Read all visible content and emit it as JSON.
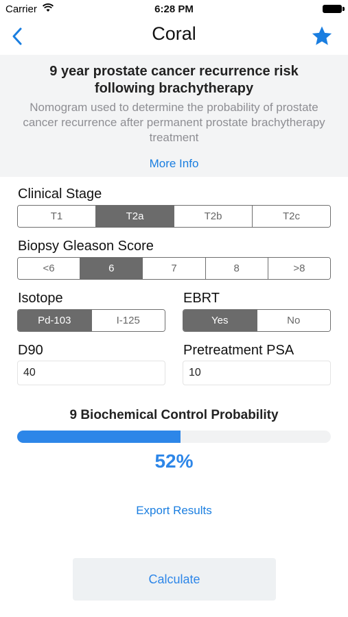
{
  "status_bar": {
    "carrier": "Carrier",
    "time": "6:28 PM"
  },
  "nav": {
    "title": "Coral",
    "back_icon": "chevron-left-icon",
    "favorite_icon": "star-icon"
  },
  "info": {
    "title": "9 year prostate cancer recurrence risk following brachytherapy",
    "description": "Nomogram used to determine the probability of prostate cancer recurrence after permanent prostate brachytherapy treatment",
    "more_info": "More Info"
  },
  "clinical_stage": {
    "label": "Clinical Stage",
    "options": [
      "T1",
      "T2a",
      "T2b",
      "T2c"
    ],
    "selected": "T2a"
  },
  "gleason": {
    "label": "Biopsy Gleason Score",
    "options": [
      "<6",
      "6",
      "7",
      "8",
      ">8"
    ],
    "selected": "6"
  },
  "isotope": {
    "label": "Isotope",
    "options": [
      "Pd-103",
      "I-125"
    ],
    "selected": "Pd-103"
  },
  "ebrt": {
    "label": "EBRT",
    "options": [
      "Yes",
      "No"
    ],
    "selected": "Yes"
  },
  "d90": {
    "label": "D90",
    "value": "40"
  },
  "psa": {
    "label": "Pretreatment PSA",
    "value": "10"
  },
  "result": {
    "title": "9 Biochemical Control Probability",
    "percent_text": "52%",
    "fraction": 0.52
  },
  "export_label": "Export Results",
  "calculate_label": "Calculate",
  "colors": {
    "accent": "#2d86e8",
    "link": "#1a7ee0",
    "selected_segment": "#6b6b6b",
    "panel": "#f3f4f5"
  }
}
